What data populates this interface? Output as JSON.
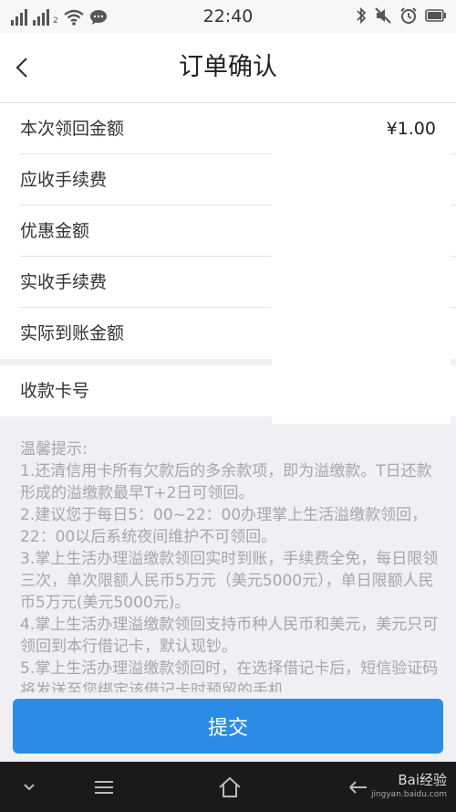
{
  "status_bar": {
    "time": "22:40",
    "sim_label": "2"
  },
  "header": {
    "title": "订单确认"
  },
  "rows": [
    {
      "label": "本次领回金额",
      "value": "¥1.00"
    },
    {
      "label": "应收手续费",
      "value": ""
    },
    {
      "label": "优惠金额",
      "value": ""
    },
    {
      "label": "实收手续费",
      "value": ""
    },
    {
      "label": "实际到账金额",
      "value": ""
    }
  ],
  "card": {
    "label": "收款卡号"
  },
  "tips": {
    "title": "温馨提示:",
    "items": [
      "1.还清信用卡所有欠款后的多余款项，即为溢缴款。T日还款形成的溢缴款最早T+2日可领回。",
      "2.建议您于每日5：00~22：00办理掌上生活溢缴款领回，22：00以后系统夜间维护不可领回。",
      "3.掌上生活办理溢缴款领回实时到账，手续费全免，每日限领三次，单次限额人民币5万元（美元5000元），单日限额人民币5万元(美元5000元)。",
      "4.掌上生活办理溢缴款领回支持币种人民币和美元，美元只可领回到本行借记卡，默认现钞。",
      "5.掌上生活办理溢缴款领回时，在选择借记卡后，短信验证码将发送至您绑定该借记卡时预留的手机"
    ]
  },
  "submit": {
    "label": "提交"
  },
  "watermark": {
    "text": "Bai经验",
    "sub": "jingyan.baidu.com"
  },
  "colors": {
    "accent": "#2b8ce6",
    "background": "#efeff4"
  },
  "icons": {
    "back": "chevron-left-icon",
    "wifi": "wifi-icon",
    "chat": "chat-bubble-icon",
    "bluetooth": "bluetooth-icon",
    "mute": "mute-icon",
    "alarm": "alarm-icon",
    "battery": "battery-icon"
  }
}
